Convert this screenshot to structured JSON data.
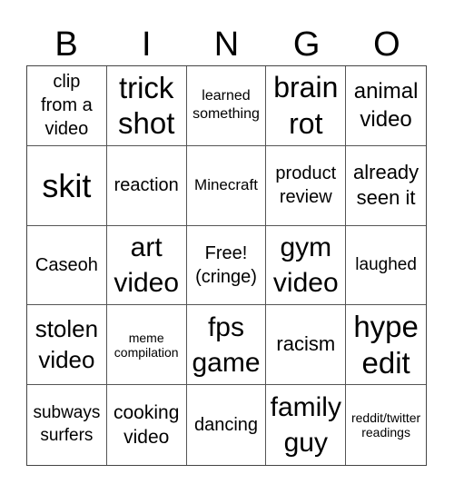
{
  "header": {
    "letters": [
      "B",
      "I",
      "N",
      "G",
      "O"
    ]
  },
  "card": {
    "rows": [
      [
        "clip\nfrom a\nvideo",
        "trick\nshot",
        "learned\nsomething",
        "brain\nrot",
        "animal\nvideo"
      ],
      [
        "skit",
        "reaction",
        "Minecraft",
        "product\nreview",
        "already\nseen it"
      ],
      [
        "Caseoh",
        "art\nvideo",
        "Free!\n(cringe)",
        "gym\nvideo",
        "laughed"
      ],
      [
        "stolen\nvideo",
        "meme\ncompilation",
        "fps\ngame",
        "racism",
        "hype\nedit"
      ],
      [
        "subways\nsurfers",
        "cooking\nvideo",
        "dancing",
        "family\nguy",
        "reddit/twitter\nreadings"
      ]
    ],
    "free_space": "Free!\n(cringe)"
  }
}
